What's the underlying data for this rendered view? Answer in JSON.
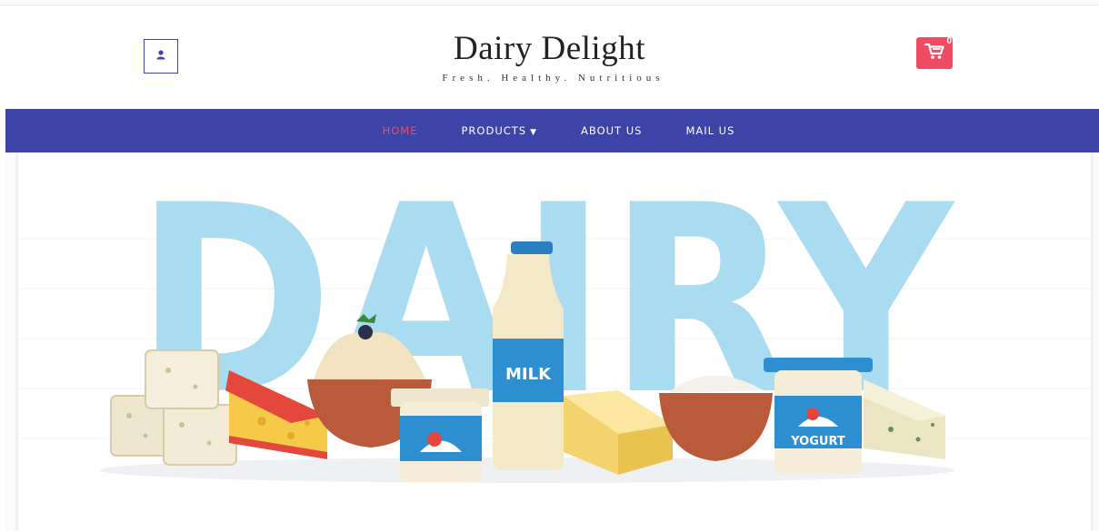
{
  "header": {
    "title": "Dairy Delight",
    "tagline": "Fresh. Healthy. Nutritious",
    "cart_count": "0",
    "user_icon": "user-icon",
    "cart_icon": "shopping-cart-icon"
  },
  "nav": {
    "items": [
      {
        "label": "HOME",
        "active": true
      },
      {
        "label": "PRODUCTS",
        "dropdown": true
      },
      {
        "label": "ABOUT US"
      },
      {
        "label": "MAIL US"
      }
    ]
  },
  "hero": {
    "headline": "DAIRY",
    "milk_label": "MILK",
    "yogurt_label": "YOGURT"
  },
  "colors": {
    "nav_bg": "#3d44a7",
    "accent": "#ef4b63",
    "hero_letters": "#a9dbf1"
  }
}
